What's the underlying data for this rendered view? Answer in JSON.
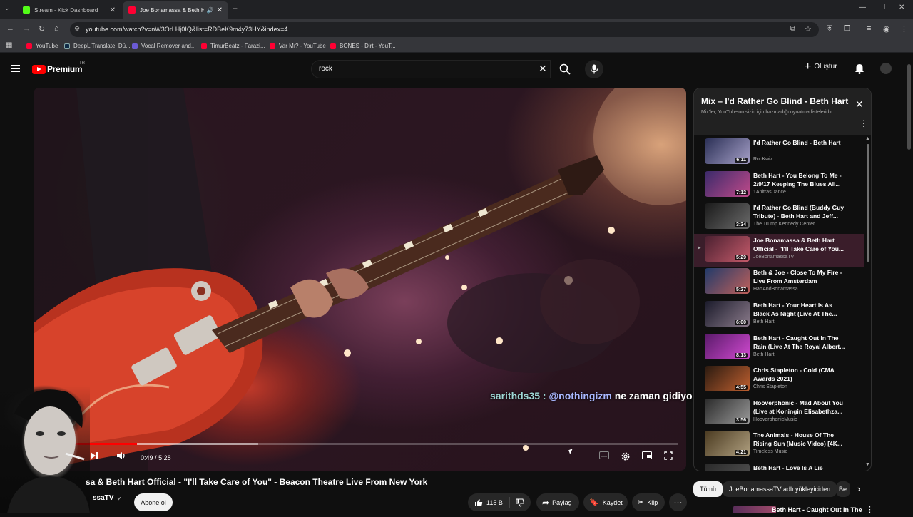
{
  "browser": {
    "tabs": [
      {
        "title": "Stream - Kick Dashboard",
        "favicon_color": "#53fc18"
      },
      {
        "title": "Joe Bonamassa & Beth Hart",
        "favicon_color": "#ff0033"
      }
    ],
    "url": "youtube.com/watch?v=nW3OrLHj0IQ&list=RDBeK9m4y73HY&index=4",
    "bookmarks": [
      {
        "label": "YouTube",
        "color": "#ff0033"
      },
      {
        "label": "DeepL Translate: Dü...",
        "color": "#0f2b46"
      },
      {
        "label": "Vocal Remover and...",
        "color": "#6b5bd6"
      },
      {
        "label": "TimurBeatz - Farazi...",
        "color": "#ff0033"
      },
      {
        "label": "Var Mı? - YouTube",
        "color": "#ff0033"
      },
      {
        "label": "BONES - Dirt - YouT...",
        "color": "#ff0033"
      }
    ]
  },
  "header": {
    "brand": "Premium",
    "region": "TR",
    "search_value": "rock",
    "create_label": "Oluştur"
  },
  "player": {
    "current_time": "0:49",
    "duration": "5:28",
    "separator": "/",
    "progress_fraction": 0.149,
    "buffer_fraction": 0.34,
    "chat": {
      "user": "sarithds35 :",
      "mention": "@nothingizm",
      "message": "ne zaman gidiyoruz Avrupa'ya"
    }
  },
  "video_info": {
    "title": "sa & Beth Hart Official - \"I'll Take Care of You\" - Beacon Theatre Live From New York",
    "channel": "ssaTV",
    "subscribe_label": "Abone ol",
    "like_count": "115 B",
    "share_label": "Paylaş",
    "save_label": "Kaydet",
    "clip_label": "Klip"
  },
  "playlist": {
    "title": "Mix – I'd Rather Go Blind - Beth Hart",
    "subtitle": "Mix'ler, YouTube'un sizin için hazırladığı oynatma listeleridir",
    "items": [
      {
        "title": "I'd Rather Go Blind - Beth Hart",
        "channel": "RocKwiz",
        "duration": "6:11",
        "thumb_a": "#2a2f55",
        "thumb_b": "#a6a0c8"
      },
      {
        "title": "Beth Hart - You Belong To Me - 2/9/17 Keeping The Blues Ali...",
        "channel": "1AnitrasDance",
        "duration": "7:12",
        "thumb_a": "#3a2a6a",
        "thumb_b": "#c04a8a"
      },
      {
        "title": "I'd Rather Go Blind (Buddy Guy Tribute) - Beth Hart and Jeff...",
        "channel": "The Trump Kennedy Center",
        "duration": "3:34",
        "thumb_a": "#1a1a1a",
        "thumb_b": "#6a6a6a"
      },
      {
        "title": "Joe Bonamassa & Beth Hart Official - \"I'll Take Care of You...",
        "channel": "JoeBonamassaTV",
        "duration": "5:29",
        "thumb_a": "#4a2030",
        "thumb_b": "#c45a6a",
        "active": true,
        "indicator": "▶"
      },
      {
        "title": "Beth & Joe - Close To My Fire - Live From Amsterdam",
        "channel": "HartAndBonamassa",
        "duration": "5:27",
        "thumb_a": "#203a6a",
        "thumb_b": "#c0605a"
      },
      {
        "title": "Beth Hart - Your Heart Is As Black As Night (Live At The...",
        "channel": "Beth Hart",
        "duration": "6:00",
        "thumb_a": "#1a1a2a",
        "thumb_b": "#8a7a8a"
      },
      {
        "title": "Beth Hart - Caught Out In The Rain (Live At The Royal Albert...",
        "channel": "Beth Hart",
        "duration": "8:13",
        "thumb_a": "#5a1a6a",
        "thumb_b": "#d04ad0"
      },
      {
        "title": "Chris Stapleton - Cold (CMA Awards 2021)",
        "channel": "Chris Stapleton",
        "duration": "4:55",
        "thumb_a": "#2a1a10",
        "thumb_b": "#c06030"
      },
      {
        "title": "Hooverphonic - Mad About You (Live at Koningin Elisabethza...",
        "channel": "HooverphonicMusic",
        "duration": "3:56",
        "thumb_a": "#2a2a2a",
        "thumb_b": "#9a9a9a"
      },
      {
        "title": "The Animals - House Of The Rising Sun (Music Video) [4K...",
        "channel": "Timeless Music",
        "duration": "4:21",
        "thumb_a": "#4a3a20",
        "thumb_b": "#b0a080"
      },
      {
        "title": "Beth Hart - Love Is A Lie",
        "channel": "",
        "duration": "",
        "thumb_a": "#2a2a2a",
        "thumb_b": "#555555"
      }
    ]
  },
  "chips": {
    "all": "Tümü",
    "uploader": "JoeBonamassaTV adlı yükleyiciden",
    "partial": "Be"
  },
  "next_video": {
    "title": "Beth Hart - Caught Out In The"
  }
}
